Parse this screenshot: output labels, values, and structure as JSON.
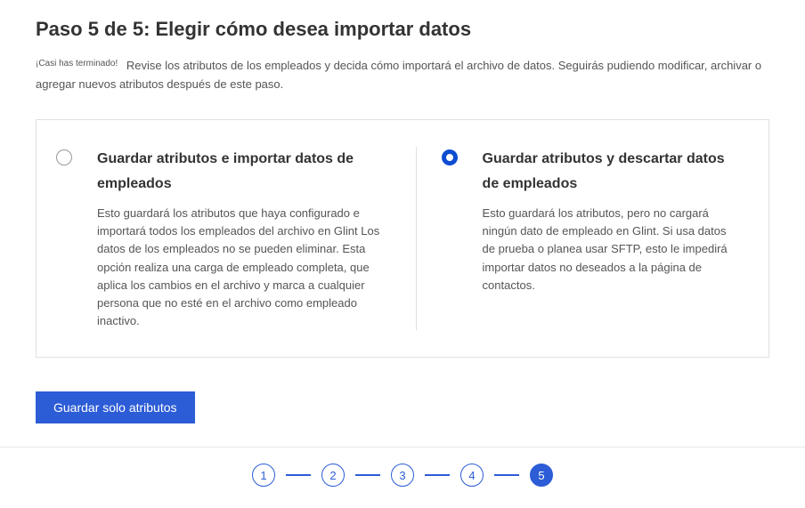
{
  "header": {
    "title": "Paso 5 de 5: Elegir cómo desea importar datos",
    "subtitle_tag": "¡Casi has terminado!",
    "subtitle_text": "Revise los atributos de los empleados y decida cómo importará el archivo de datos. Seguirás pudiendo modificar, archivar o agregar nuevos atributos después de este paso."
  },
  "options": {
    "left": {
      "selected": false,
      "title": "Guardar atributos e importar datos de empleados",
      "desc": "Esto guardará los atributos que haya configurado e importará todos los empleados del archivo en Glint Los datos de los empleados no se pueden eliminar. Esta opción realiza una carga de empleado completa, que aplica los cambios en el archivo y marca a cualquier persona que no esté en el archivo como empleado inactivo."
    },
    "right": {
      "selected": true,
      "title": "Guardar atributos y descartar datos de empleados",
      "desc": "Esto guardará los atributos, pero no cargará ningún dato de empleado en Glint. Si usa datos de prueba o planea usar SFTP, esto le impedirá importar datos no deseados a la página de contactos."
    }
  },
  "actions": {
    "primary_label": "Guardar solo atributos"
  },
  "stepper": {
    "steps": [
      "1",
      "2",
      "3",
      "4",
      "5"
    ],
    "current": 5
  }
}
